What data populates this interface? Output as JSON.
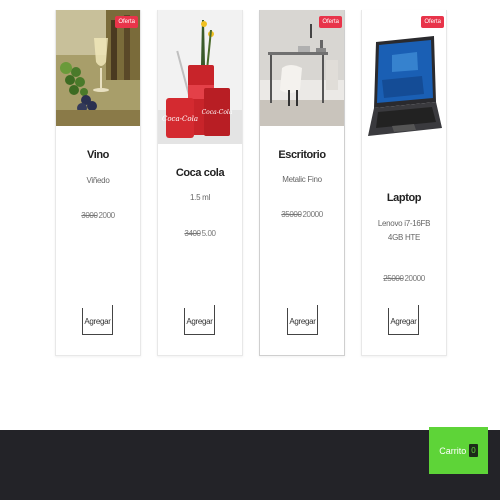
{
  "products": [
    {
      "name": "Vino",
      "description": "Viñedo",
      "old_price": "3000",
      "price": "2000",
      "badge": "Oferta",
      "add_label": "Agregar",
      "image_icon": "wine-grapes-image"
    },
    {
      "name": "Coca cola",
      "description": "1.5 ml",
      "old_price": "3400",
      "price": "5.00",
      "badge": "",
      "add_label": "Agregar",
      "image_icon": "coca-cola-image"
    },
    {
      "name": "Escritorio",
      "description": "Metalic Fino",
      "old_price": "35000",
      "price": "20000",
      "badge": "Oferta",
      "add_label": "Agregar",
      "image_icon": "desk-image"
    },
    {
      "name": "Laptop",
      "description": "Lenovo i7-16FB 4GB HTE",
      "old_price": "25000",
      "price": "20000",
      "badge": "Oferta",
      "add_label": "Agregar",
      "image_icon": "laptop-image"
    }
  ],
  "cart": {
    "label": "Carrito",
    "count": "0"
  },
  "colors": {
    "badge": "#e8344a",
    "cart": "#5ed438",
    "footer": "#232328"
  }
}
